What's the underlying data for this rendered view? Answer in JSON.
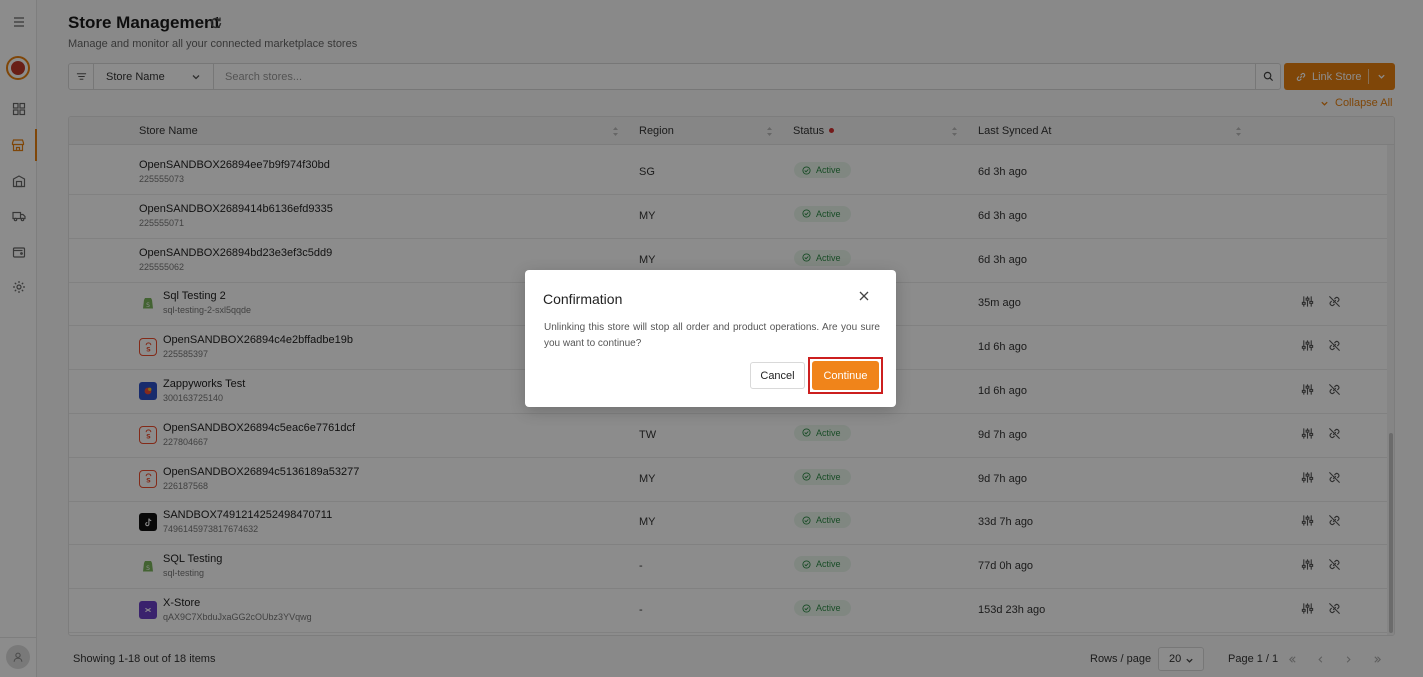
{
  "header": {
    "title": "Store Management",
    "subtitle": "Manage and monitor all your connected marketplace stores"
  },
  "toolbar": {
    "filter_field": "Store Name",
    "search_placeholder": "Search stores...",
    "link_store_label": "Link Store",
    "collapse_all_label": "Collapse All"
  },
  "table": {
    "columns": [
      "Store Name",
      "Region",
      "Status",
      "Last Synced At"
    ],
    "rows": [
      {
        "name": "OpenSANDBOX26894ee7b9f974f30bd",
        "sub": "225555073",
        "region": "SG",
        "status": "Active",
        "synced": "6d 3h ago",
        "icon": "none"
      },
      {
        "name": "OpenSANDBOX2689414b6136efd9335",
        "sub": "225555071",
        "region": "MY",
        "status": "Active",
        "synced": "6d 3h ago",
        "icon": "none"
      },
      {
        "name": "OpenSANDBOX26894bd23e3ef3c5dd9",
        "sub": "225555062",
        "region": "MY",
        "status": "Active",
        "synced": "6d 3h ago",
        "icon": "none"
      },
      {
        "name": "Sql Testing 2",
        "sub": "sql-testing-2-sxl5qqde",
        "region": "",
        "status": "",
        "synced": "35m ago",
        "icon": "shopify-icon"
      },
      {
        "name": "OpenSANDBOX26894c4e2bffadbe19b",
        "sub": "225585397",
        "region": "",
        "status": "",
        "synced": "1d 6h ago",
        "icon": "shopee-icon"
      },
      {
        "name": "Zappyworks Test",
        "sub": "300163725140",
        "region": "",
        "status": "",
        "synced": "1d 6h ago",
        "icon": "zappyworks-icon"
      },
      {
        "name": "OpenSANDBOX26894c5eac6e7761dcf",
        "sub": "227804667",
        "region": "TW",
        "status": "Active",
        "synced": "9d 7h ago",
        "icon": "shopee-icon"
      },
      {
        "name": "OpenSANDBOX26894c5136189a53277",
        "sub": "226187568",
        "region": "MY",
        "status": "Active",
        "synced": "9d 7h ago",
        "icon": "shopee-icon"
      },
      {
        "name": "SANDBOX7491214252498470711",
        "sub": "7496145973817674632",
        "region": "MY",
        "status": "Active",
        "synced": "33d 7h ago",
        "icon": "tiktok-icon"
      },
      {
        "name": "SQL Testing",
        "sub": "sql-testing",
        "region": "-",
        "status": "Active",
        "synced": "77d 0h ago",
        "icon": "shopify-icon"
      },
      {
        "name": "X-Store",
        "sub": "qAX9C7XbduJxaGG2cOUbz3YVqwg",
        "region": "-",
        "status": "Active",
        "synced": "153d 23h ago",
        "icon": "xstore-icon"
      }
    ]
  },
  "footer": {
    "showing": "Showing 1-18 out of 18 items",
    "rows_label": "Rows / page",
    "rows_value": "20",
    "page_label": "Page 1 / 1"
  },
  "modal": {
    "title": "Confirmation",
    "message": "Unlinking this store will stop all order and product operations. Are you sure you want to continue?",
    "cancel_label": "Cancel",
    "continue_label": "Continue"
  },
  "colors": {
    "accent": "#e8800f",
    "active_green": "#2e8b46",
    "highlight_red": "#cc1f1f"
  }
}
